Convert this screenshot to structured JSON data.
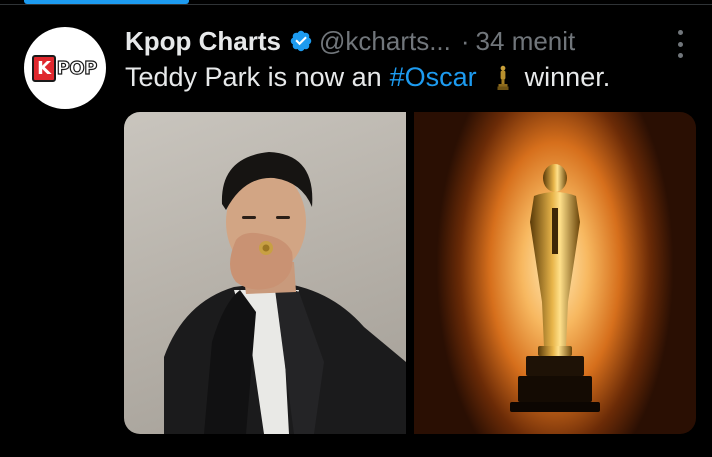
{
  "tweet": {
    "author": {
      "display_name": "Kpop Charts",
      "handle": "@kcharts...",
      "avatar_logo_left": "K",
      "avatar_logo_right": "POP",
      "verified": true
    },
    "separator": "·",
    "timestamp": "34 menit",
    "text_prefix": "Teddy Park is now an",
    "hashtag": "#Oscar",
    "emoji_name": "trophy-icon",
    "text_suffix": "winner.",
    "media": [
      {
        "name": "teddy-park-portrait"
      },
      {
        "name": "oscar-statue-photo"
      }
    ]
  },
  "colors": {
    "background": "#000000",
    "text_primary": "#e7e9ea",
    "text_secondary": "#71767b",
    "link": "#1d9bf0",
    "verified": "#1d9bf0",
    "divider": "#2f3336"
  }
}
